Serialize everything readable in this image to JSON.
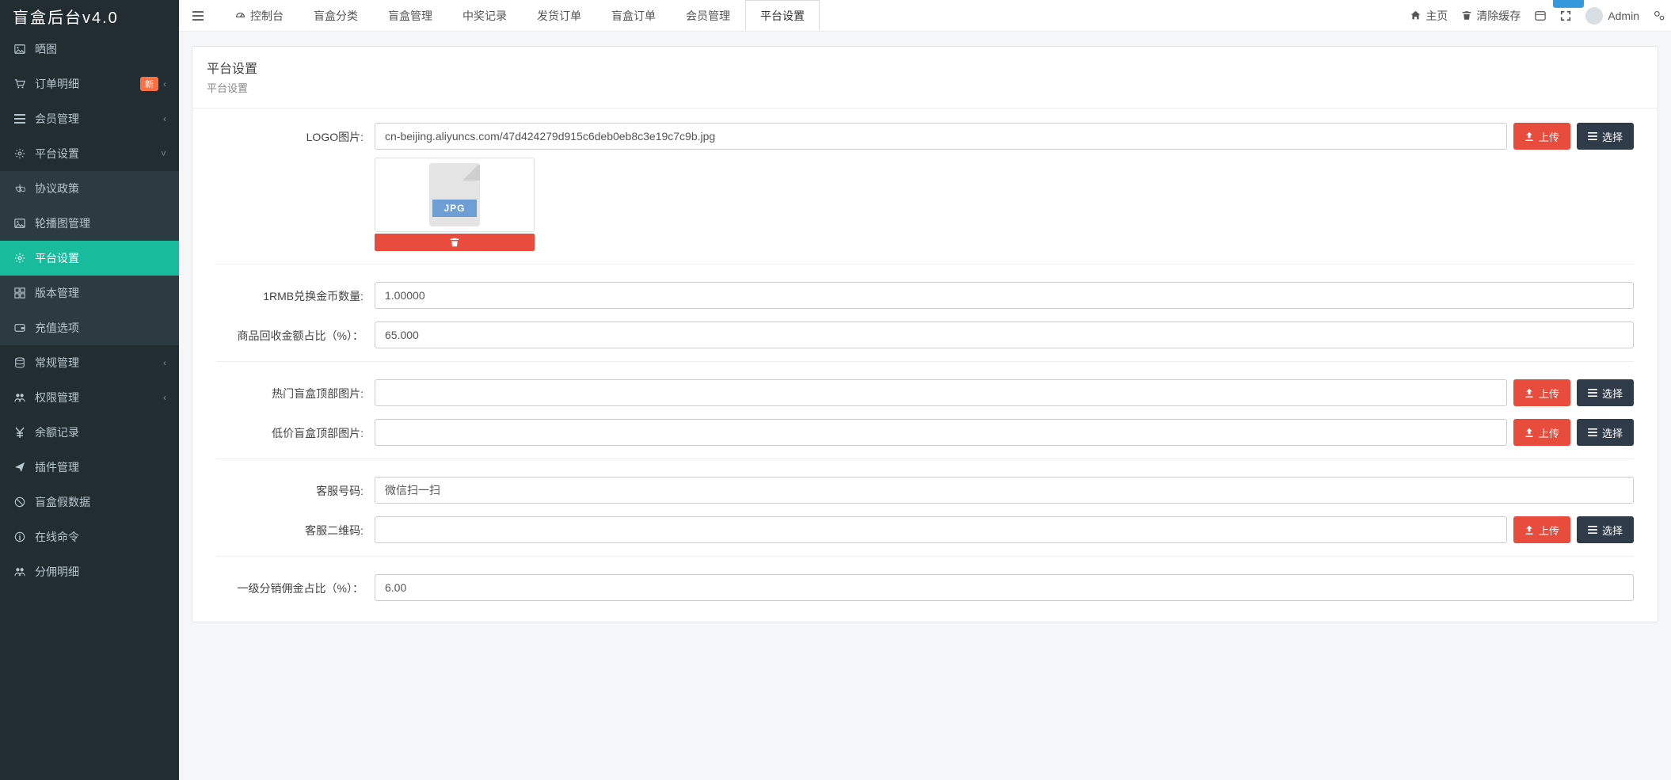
{
  "brand": "盲盒后台v4.0",
  "sidebar": {
    "items": [
      {
        "icon": "image-icon",
        "label": "晒图"
      },
      {
        "icon": "cart-icon",
        "label": "订单明细",
        "badge": "新",
        "chev": "‹"
      },
      {
        "icon": "list-icon",
        "label": "会员管理",
        "chev": "‹"
      },
      {
        "icon": "gear-icon",
        "label": "平台设置",
        "chev": "˅"
      },
      {
        "icon": "balance-icon",
        "label": "协议政策",
        "sub": true
      },
      {
        "icon": "image-icon",
        "label": "轮播图管理",
        "sub": true
      },
      {
        "icon": "gear-icon",
        "label": "平台设置",
        "sub": true,
        "active": true
      },
      {
        "icon": "grid-icon",
        "label": "版本管理",
        "sub": true
      },
      {
        "icon": "wallet-icon",
        "label": "充值选项",
        "sub": true
      },
      {
        "icon": "db-icon",
        "label": "常规管理",
        "chev": "‹"
      },
      {
        "icon": "users-icon",
        "label": "权限管理",
        "chev": "‹"
      },
      {
        "icon": "yen-icon",
        "label": "余额记录"
      },
      {
        "icon": "plane-icon",
        "label": "插件管理"
      },
      {
        "icon": "ban-icon",
        "label": "盲盒假数据"
      },
      {
        "icon": "info-icon",
        "label": "在线命令"
      },
      {
        "icon": "users-icon",
        "label": "分佣明细"
      }
    ]
  },
  "top_tabs": [
    {
      "label": "控制台",
      "icon": "dashboard-icon"
    },
    {
      "label": "盲盒分类"
    },
    {
      "label": "盲盒管理"
    },
    {
      "label": "中奖记录"
    },
    {
      "label": "发货订单"
    },
    {
      "label": "盲盒订单"
    },
    {
      "label": "会员管理"
    },
    {
      "label": "平台设置",
      "active": true
    }
  ],
  "top_right": {
    "home": "主页",
    "clear": "清除缓存",
    "user": "Admin"
  },
  "page": {
    "title": "平台设置",
    "subtitle": "平台设置"
  },
  "buttons": {
    "upload": "上传",
    "choose": "选择"
  },
  "form": {
    "logo_label": "LOGO图片:",
    "logo_value": "cn-beijing.aliyuncs.com/47d424279d915c6deb0eb8c3e19c7c9b.jpg",
    "file_badge": "JPG",
    "rmb_label": "1RMB兑换金币数量:",
    "rmb_value": "1.00000",
    "recycle_label": "商品回收金额占比（%）：",
    "recycle_value": "65.000",
    "hot_img_label": "热门盲盒顶部图片:",
    "hot_img_value": "",
    "cheap_img_label": "低价盲盒顶部图片:",
    "cheap_img_value": "",
    "svc_num_label": "客服号码:",
    "svc_num_value": "微信扫一扫",
    "svc_qr_label": "客服二维码:",
    "svc_qr_value": "",
    "lv1_label": "一级分销佣金占比（%）：",
    "lv1_value": "6.00"
  }
}
